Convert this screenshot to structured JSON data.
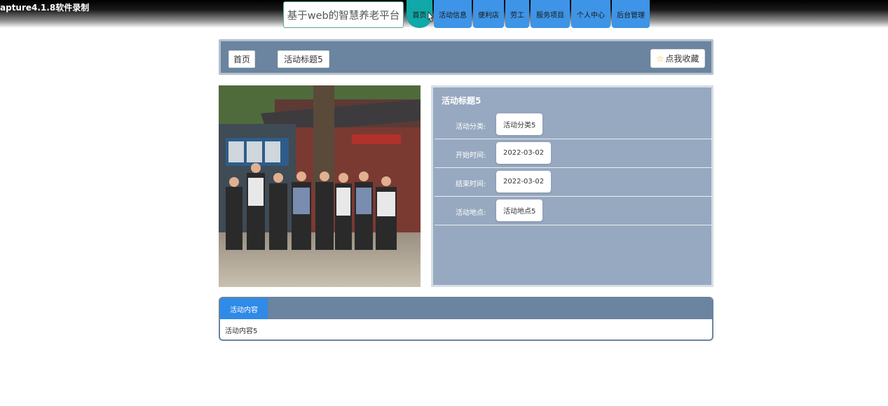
{
  "recorder": {
    "text": "apture4.1.8软件录制"
  },
  "site": {
    "title": "基于web的智慧养老平台"
  },
  "nav": {
    "items": [
      {
        "label": "首页",
        "active": true
      },
      {
        "label": "活动信息"
      },
      {
        "label": "便利店"
      },
      {
        "label": "劳工"
      },
      {
        "label": "服务项目"
      },
      {
        "label": "个人中心"
      },
      {
        "label": "后台管理"
      }
    ]
  },
  "breadcrumb": {
    "home": "首页",
    "current": "活动标题5",
    "favorite": "点我收藏"
  },
  "detail": {
    "title": "活动标题5",
    "rows": [
      {
        "label": "活动分类:",
        "value": "活动分类5"
      },
      {
        "label": "开始时间:",
        "value": "2022-03-02"
      },
      {
        "label": "结束时间:",
        "value": "2022-03-02"
      },
      {
        "label": "活动地点:",
        "value": "活动地点5"
      }
    ]
  },
  "content": {
    "tab": "活动内容",
    "body": "活动内容5"
  },
  "colors": {
    "nav_blue": "#3e94e6",
    "nav_active": "#10a8a8",
    "panel": "#6b849f",
    "detail": "#97a9c0",
    "tab": "#2f8ae8"
  }
}
